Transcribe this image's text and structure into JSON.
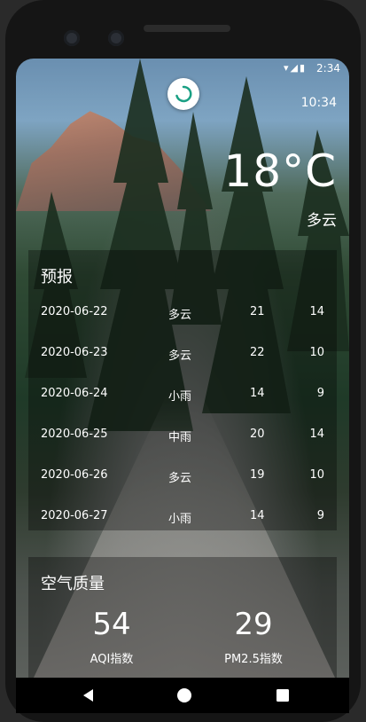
{
  "status_bar": {
    "time": "2:34",
    "icons": [
      "wifi-icon",
      "signal-icon",
      "battery-icon"
    ]
  },
  "header": {
    "update_time": "10:34",
    "temperature": "18°C",
    "condition": "多云"
  },
  "forecast": {
    "title": "预报",
    "rows": [
      {
        "date": "2020-06-22",
        "condition": "多云",
        "max": "21",
        "min": "14"
      },
      {
        "date": "2020-06-23",
        "condition": "多云",
        "max": "22",
        "min": "10"
      },
      {
        "date": "2020-06-24",
        "condition": "小雨",
        "max": "14",
        "min": "9"
      },
      {
        "date": "2020-06-25",
        "condition": "中雨",
        "max": "20",
        "min": "14"
      },
      {
        "date": "2020-06-26",
        "condition": "多云",
        "max": "19",
        "min": "10"
      },
      {
        "date": "2020-06-27",
        "condition": "小雨",
        "max": "14",
        "min": "9"
      }
    ]
  },
  "air_quality": {
    "title": "空气质量",
    "aqi": {
      "value": "54",
      "label": "AQI指数"
    },
    "pm25": {
      "value": "29",
      "label": "PM2.5指数"
    }
  },
  "nav": {
    "icons": [
      "back-icon",
      "home-icon",
      "recents-icon"
    ]
  }
}
